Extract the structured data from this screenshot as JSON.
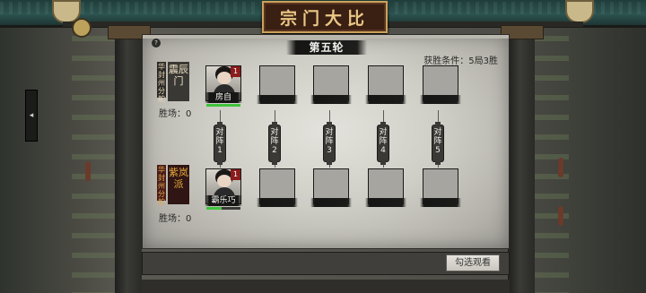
{
  "title": "宗门大比",
  "round": "第五轮",
  "win_condition": "获胜条件：5局3胜",
  "help_icon": "?",
  "teams": [
    {
      "region": "华封州分舵",
      "sect": "震辰门",
      "wins_label": "胜场：0",
      "players": [
        {
          "name": "房自",
          "rank": "1",
          "hp": 1.0
        }
      ]
    },
    {
      "region": "华封州分舵",
      "sect": "紫岚派",
      "wins_label": "胜场：0",
      "players": [
        {
          "name": "霸乐巧",
          "rank": "1",
          "hp": 0.45
        }
      ]
    }
  ],
  "matches": [
    "对阵1",
    "对阵2",
    "对阵3",
    "对阵4",
    "对阵5"
  ],
  "watch_button": "勾选观看"
}
